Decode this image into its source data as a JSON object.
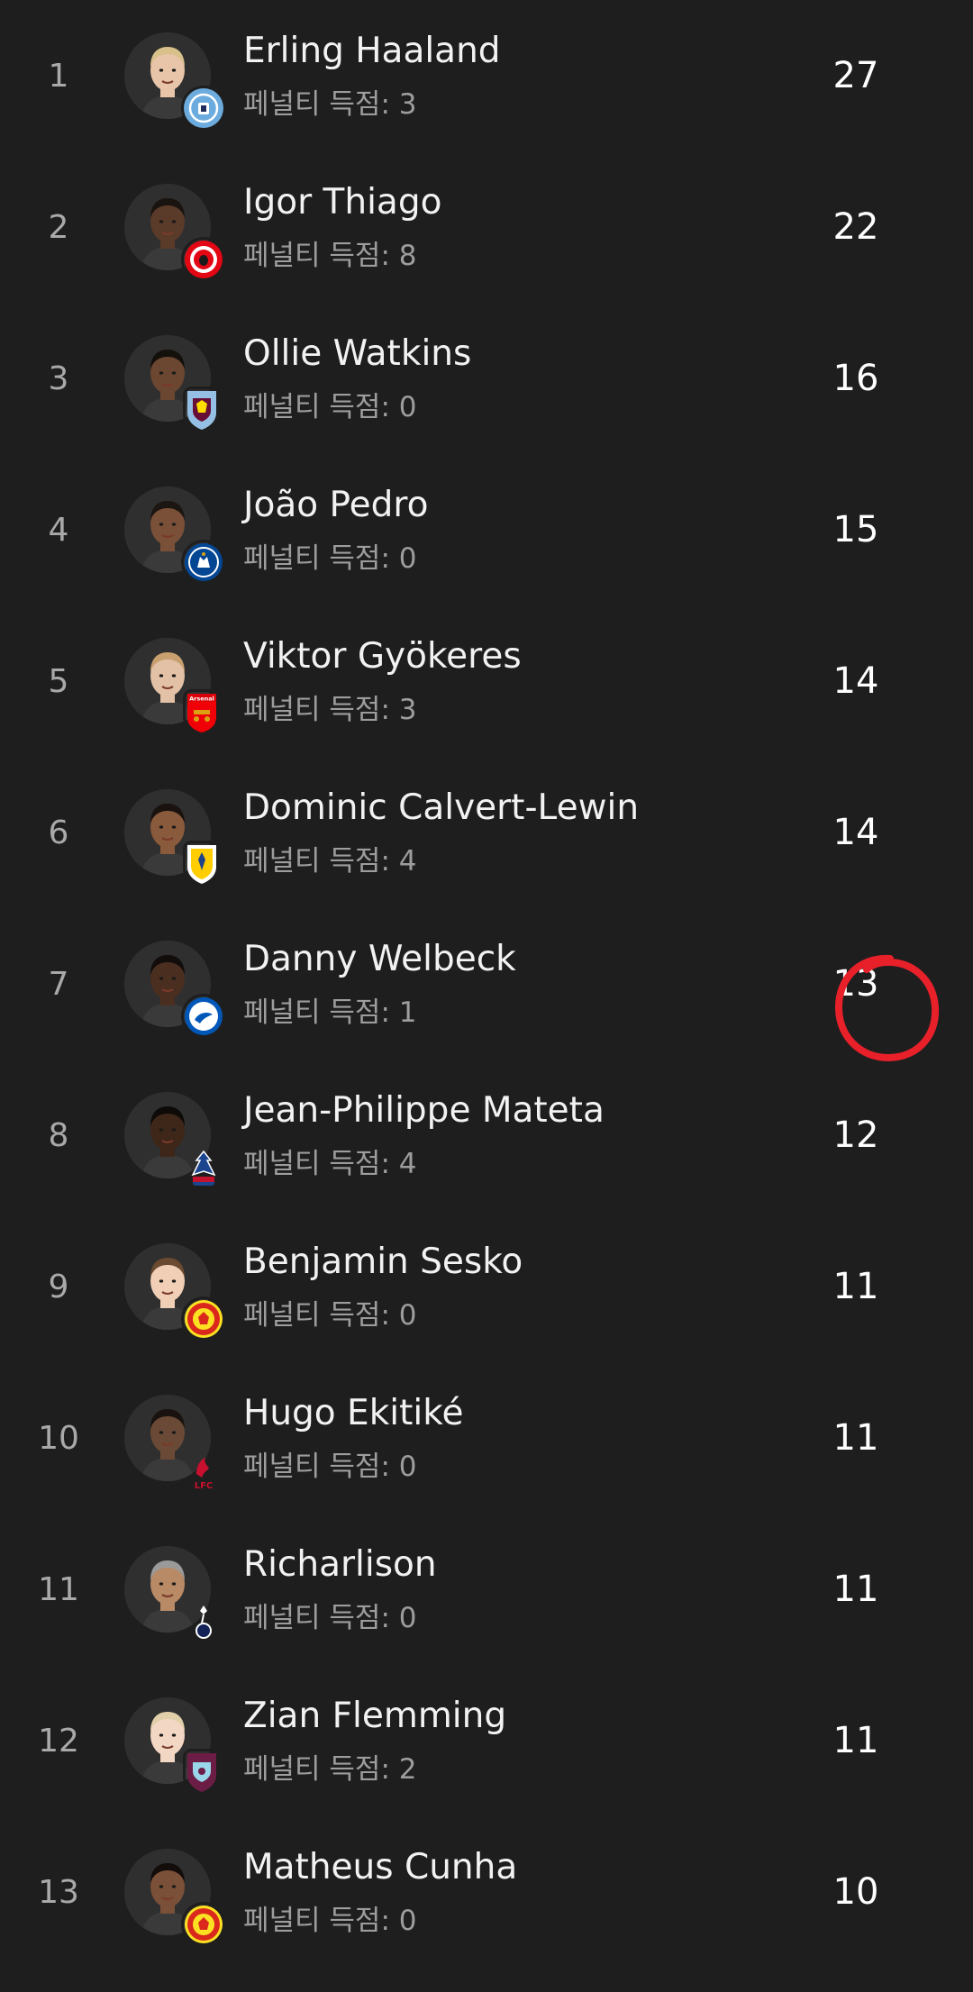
{
  "penalty_label": "페널티 득점: ",
  "players": [
    {
      "rank": "1",
      "name": "Erling Haaland",
      "penalties": "3",
      "goals": "27",
      "club_icon": "man-city-crest",
      "club_color": "#6cabdd"
    },
    {
      "rank": "2",
      "name": "Igor Thiago",
      "penalties": "8",
      "goals": "22",
      "club_icon": "brentford-crest",
      "club_color": "#e30613"
    },
    {
      "rank": "3",
      "name": "Ollie Watkins",
      "penalties": "0",
      "goals": "16",
      "club_icon": "aston-villa-crest",
      "club_color": "#95bfe5"
    },
    {
      "rank": "4",
      "name": "João Pedro",
      "penalties": "0",
      "goals": "15",
      "club_icon": "chelsea-crest",
      "club_color": "#034694"
    },
    {
      "rank": "5",
      "name": "Viktor Gyökeres",
      "penalties": "3",
      "goals": "14",
      "club_icon": "arsenal-crest",
      "club_color": "#ef0107"
    },
    {
      "rank": "6",
      "name": "Dominic Calvert-Lewin",
      "penalties": "4",
      "goals": "14",
      "club_icon": "leeds-crest",
      "club_color": "#ffcd00"
    },
    {
      "rank": "7",
      "name": "Danny Welbeck",
      "penalties": "1",
      "goals": "13",
      "club_icon": "brighton-crest",
      "club_color": "#0057b8"
    },
    {
      "rank": "8",
      "name": "Jean-Philippe Mateta",
      "penalties": "4",
      "goals": "12",
      "club_icon": "crystal-palace-crest",
      "club_color": "#1b458f"
    },
    {
      "rank": "9",
      "name": "Benjamin Sesko",
      "penalties": "0",
      "goals": "11",
      "club_icon": "man-united-crest",
      "club_color": "#da291c"
    },
    {
      "rank": "10",
      "name": "Hugo Ekitiké",
      "penalties": "0",
      "goals": "11",
      "club_icon": "liverpool-crest",
      "club_color": "#c8102e"
    },
    {
      "rank": "11",
      "name": "Richarlison",
      "penalties": "0",
      "goals": "11",
      "club_icon": "tottenham-crest",
      "club_color": "#132257"
    },
    {
      "rank": "12",
      "name": "Zian Flemming",
      "penalties": "2",
      "goals": "11",
      "club_icon": "burnley-crest",
      "club_color": "#6c1d45"
    },
    {
      "rank": "13",
      "name": "Matheus Cunha",
      "penalties": "0",
      "goals": "10",
      "club_icon": "man-united-crest",
      "club_color": "#da291c"
    }
  ],
  "highlight": {
    "row_rank": "7",
    "annotation_color": "#e8202a"
  }
}
